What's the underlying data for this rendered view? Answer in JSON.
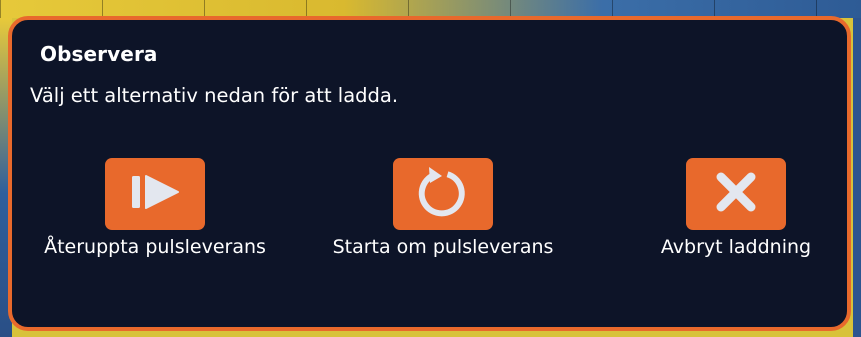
{
  "dialog": {
    "title": "Observera",
    "message": "Välj ett alternativ nedan för att ladda.",
    "accent_color": "#e8692c",
    "background_color": "#0d1428",
    "options": [
      {
        "label": "Återuppta pulsleverans",
        "icon": "resume-play-icon"
      },
      {
        "label": "Starta om pulsleverans",
        "icon": "restart-icon"
      },
      {
        "label": "Avbryt laddning",
        "icon": "close-x-icon"
      }
    ]
  }
}
